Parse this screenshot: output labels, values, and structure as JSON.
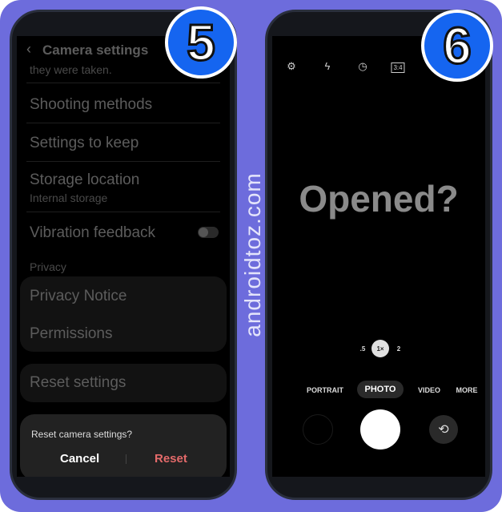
{
  "watermark": "androidtoz.com",
  "colors": {
    "background": "#6d6cdc",
    "badge": "#1565f0",
    "reset": "#e46a6a"
  },
  "left": {
    "badge": "5",
    "header": {
      "back_icon": "chevron-left-icon",
      "title": "Camera settings"
    },
    "partial_text": "they were taken.",
    "items": [
      {
        "label": "Shooting methods"
      },
      {
        "label": "Settings to keep"
      },
      {
        "label": "Storage location",
        "sub": "Internal storage"
      },
      {
        "label": "Vibration feedback",
        "toggle": false
      }
    ],
    "privacy_header": "Privacy",
    "privacy_items": [
      "Privacy Notice",
      "Permissions"
    ],
    "reset_settings": "Reset settings",
    "dialog": {
      "message": "Reset camera settings?",
      "cancel": "Cancel",
      "confirm": "Reset"
    }
  },
  "right": {
    "badge": "6",
    "top_icons": [
      "gear-icon",
      "flash-off-icon",
      "timer-icon",
      "aspect-ratio-icon"
    ],
    "ratio_label": "3:4",
    "overlay_text": "Opened?",
    "zoom": [
      ".5",
      "1×",
      "2"
    ],
    "zoom_selected": "1×",
    "modes": [
      "PORTRAIT",
      "PHOTO",
      "VIDEO",
      "MORE"
    ],
    "mode_selected": "PHOTO"
  }
}
